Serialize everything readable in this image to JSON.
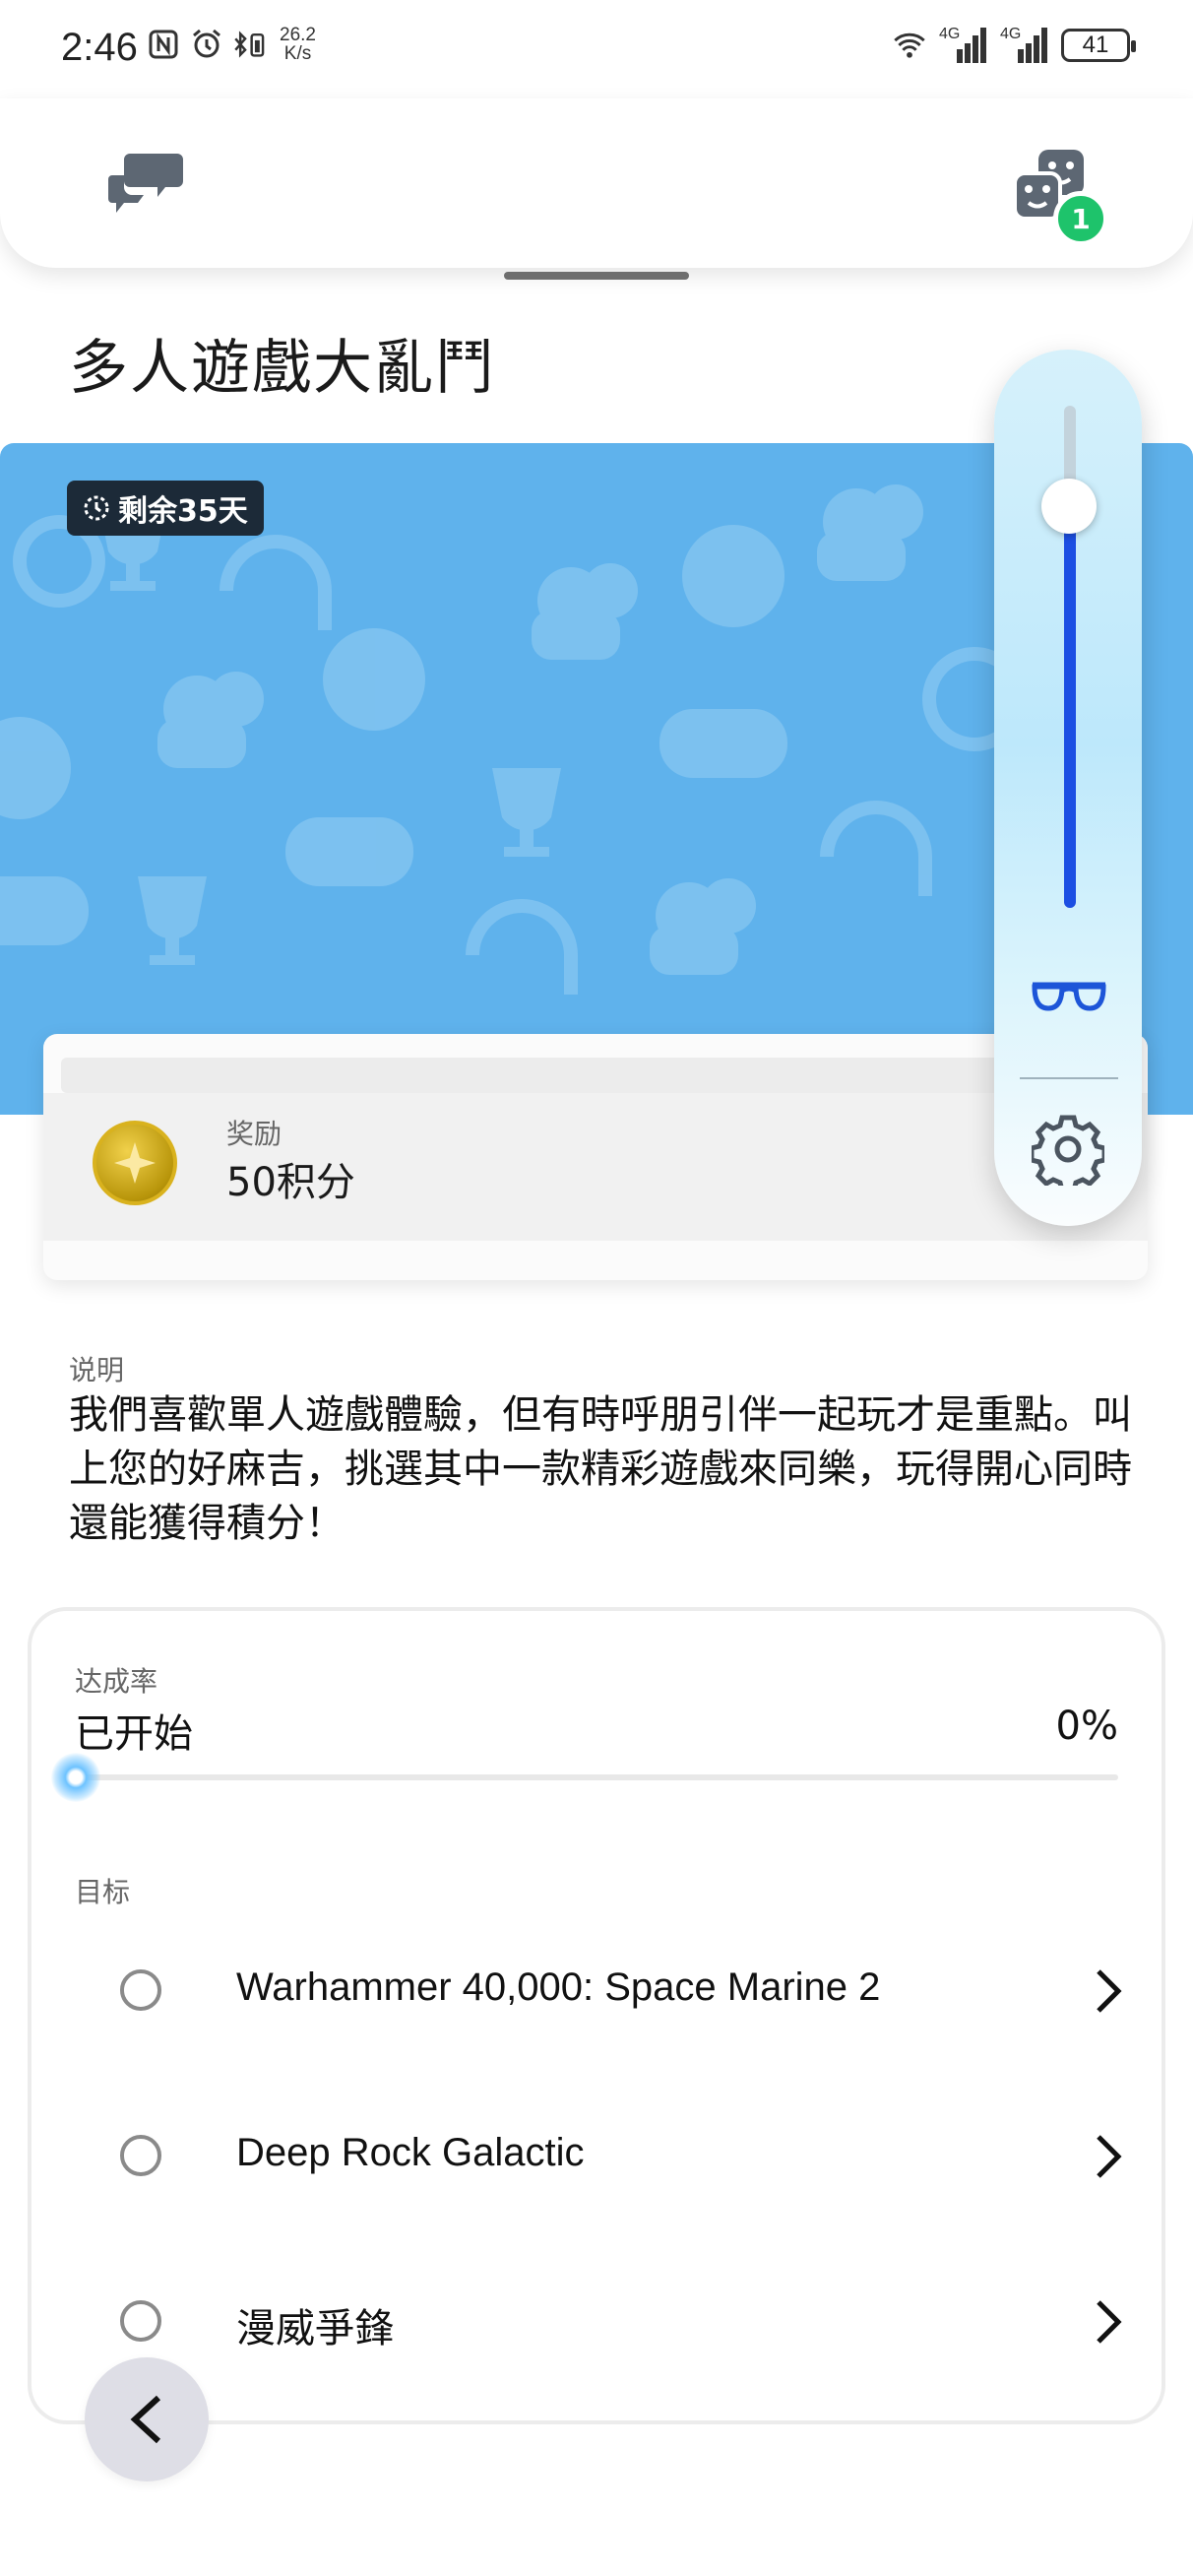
{
  "status_bar": {
    "time": "2:46",
    "net_speed_value": "26.2",
    "net_speed_unit": "K/s",
    "signal_1_label": "4G",
    "signal_2_label": "4G",
    "battery": "41"
  },
  "header": {
    "chat_icon": "chat-bubbles-icon",
    "games_icon": "game-dice-icon",
    "games_badge": "1"
  },
  "page": {
    "title": "多人遊戲大亂鬥"
  },
  "banner": {
    "background_color": "#5fb2ec",
    "days_left": "剩余35天"
  },
  "reward": {
    "label": "奖励",
    "value": "50积分"
  },
  "float_panel": {
    "slider_level": 0.8,
    "slider_fill_color": "#1c4fe3",
    "glasses_icon": "glasses-icon",
    "gear_icon": "gear-icon"
  },
  "description": {
    "label": "说明",
    "text": "我們喜歡單人遊戲體驗，但有時呼朋引伴一起玩才是重點。叫上您的好麻吉，挑選其中一款精彩遊戲來同樂，玩得開心同時還能獲得積分！"
  },
  "progress": {
    "label": "达成率",
    "status": "已开始",
    "percent_text": "0%",
    "percent": 0
  },
  "goals": {
    "label": "目标",
    "items": [
      {
        "name": "Warhammer 40,000: Space Marine 2"
      },
      {
        "name": "Deep Rock Galactic"
      },
      {
        "name": "漫威爭鋒"
      }
    ]
  },
  "nav": {
    "back_icon": "chevron-left-icon"
  }
}
